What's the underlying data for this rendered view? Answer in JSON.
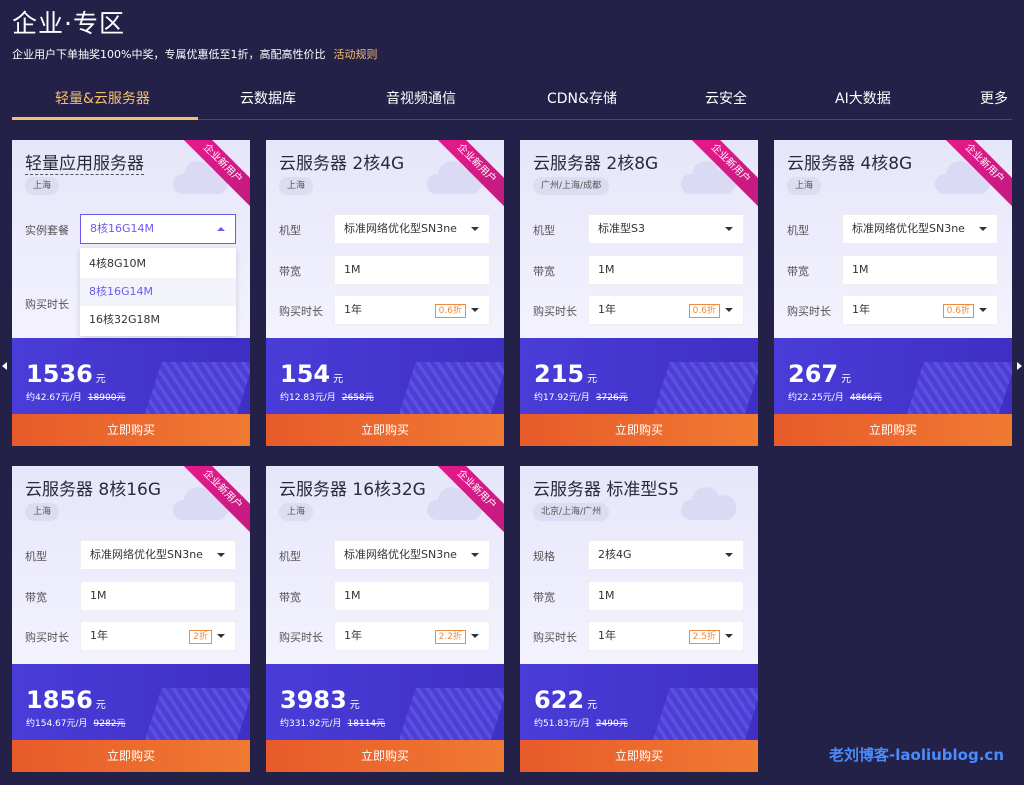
{
  "header": {
    "title": "企业·专区",
    "subtitle": "企业用户下单抽奖100%中奖，专属优惠低至1折，高配高性价比",
    "rule_link": "活动规则"
  },
  "tabs": [
    "轻量&云服务器",
    "云数据库",
    "音视频通信",
    "CDN&存储",
    "云安全",
    "AI大数据",
    "更多"
  ],
  "ribbon_text": "企业新用户",
  "buy_label": "立即购买",
  "price_unit": "元",
  "cards": [
    {
      "title": "轻量应用服务器",
      "region": "上海",
      "row1_label": "实例套餐",
      "row1_value": "8核16G14M",
      "row3_label": "购买时长",
      "price": "1536",
      "monthly": "约42.67元/月",
      "original": "18900元",
      "dropdown": [
        "4核8G10M",
        "8核16G14M",
        "16核32G18M"
      ]
    },
    {
      "title": "云服务器 2核4G",
      "region": "上海",
      "row1_label": "机型",
      "row1_value": "标准网络优化型SN3ne",
      "row2_label": "带宽",
      "row2_value": "1M",
      "row3_label": "购买时长",
      "row3_value": "1年",
      "discount": "0.6折",
      "price": "154",
      "monthly": "约12.83元/月",
      "original": "2658元"
    },
    {
      "title": "云服务器 2核8G",
      "region": "广州/上海/成都",
      "row1_label": "机型",
      "row1_value": "标准型S3",
      "row2_label": "带宽",
      "row2_value": "1M",
      "row3_label": "购买时长",
      "row3_value": "1年",
      "discount": "0.6折",
      "price": "215",
      "monthly": "约17.92元/月",
      "original": "3726元"
    },
    {
      "title": "云服务器 4核8G",
      "region": "上海",
      "row1_label": "机型",
      "row1_value": "标准网络优化型SN3ne",
      "row2_label": "带宽",
      "row2_value": "1M",
      "row3_label": "购买时长",
      "row3_value": "1年",
      "discount": "0.6折",
      "price": "267",
      "monthly": "约22.25元/月",
      "original": "4866元"
    },
    {
      "title": "云服务器 8核16G",
      "region": "上海",
      "row1_label": "机型",
      "row1_value": "标准网络优化型SN3ne",
      "row2_label": "带宽",
      "row2_value": "1M",
      "row3_label": "购买时长",
      "row3_value": "1年",
      "discount": "2折",
      "price": "1856",
      "monthly": "约154.67元/月",
      "original": "9282元"
    },
    {
      "title": "云服务器 16核32G",
      "region": "上海",
      "row1_label": "机型",
      "row1_value": "标准网络优化型SN3ne",
      "row2_label": "带宽",
      "row2_value": "1M",
      "row3_label": "购买时长",
      "row3_value": "1年",
      "discount": "2.2折",
      "price": "3983",
      "monthly": "约331.92元/月",
      "original": "18114元"
    },
    {
      "title": "云服务器 标准型S5",
      "region": "北京/上海/广州",
      "row1_label": "规格",
      "row1_value": "2核4G",
      "row2_label": "带宽",
      "row2_value": "1M",
      "row3_label": "购买时长",
      "row3_value": "1年",
      "discount": "2.5折",
      "price": "622",
      "monthly": "约51.83元/月",
      "original": "2490元"
    }
  ],
  "watermark": "老刘博客-laoliublog.cn"
}
